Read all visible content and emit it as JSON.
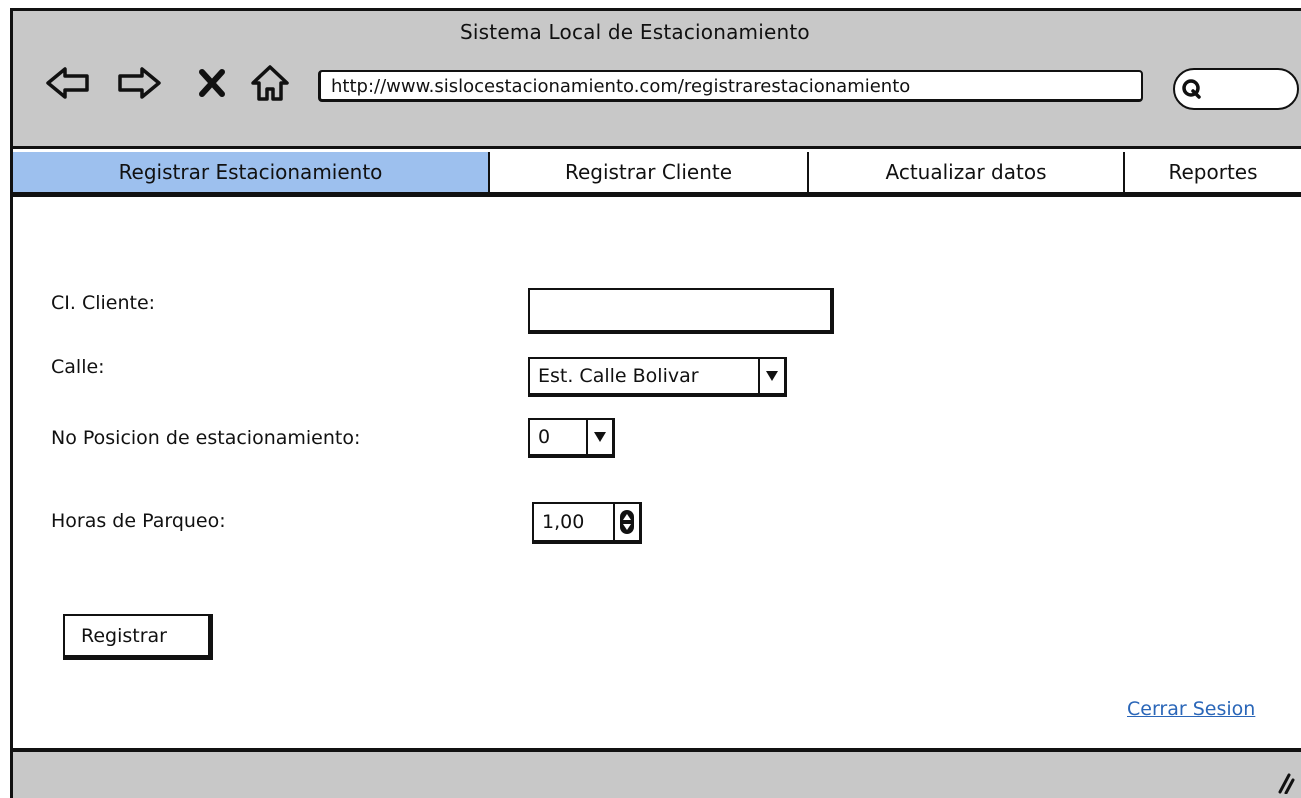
{
  "window": {
    "title": "Sistema Local de Estacionamiento"
  },
  "browser": {
    "back_icon": "back-arrow-icon",
    "forward_icon": "forward-arrow-icon",
    "stop_icon": "close-icon",
    "home_icon": "home-icon",
    "url": "http://www.sislocestacionamiento.com/registrarestacionamiento",
    "search_icon": "search-icon"
  },
  "tabs": [
    {
      "label": "Registrar Estacionamiento",
      "active": true
    },
    {
      "label": "Registrar Cliente",
      "active": false
    },
    {
      "label": "Actualizar datos",
      "active": false
    },
    {
      "label": "Reportes",
      "active": false
    }
  ],
  "form": {
    "ci_cliente": {
      "label": "CI. Cliente:",
      "value": ""
    },
    "calle": {
      "label": "Calle:",
      "value": "Est. Calle Bolivar"
    },
    "posicion": {
      "label": "No Posicion de estacionamiento:",
      "value": "0"
    },
    "horas": {
      "label": "Horas de Parqueo:",
      "value": "1,00"
    },
    "submit_label": "Registrar"
  },
  "logout_label": "Cerrar Sesion",
  "colors": {
    "chrome_bg": "#c8c8c8",
    "active_tab": "#9dc0ee",
    "link": "#2a66b8"
  }
}
